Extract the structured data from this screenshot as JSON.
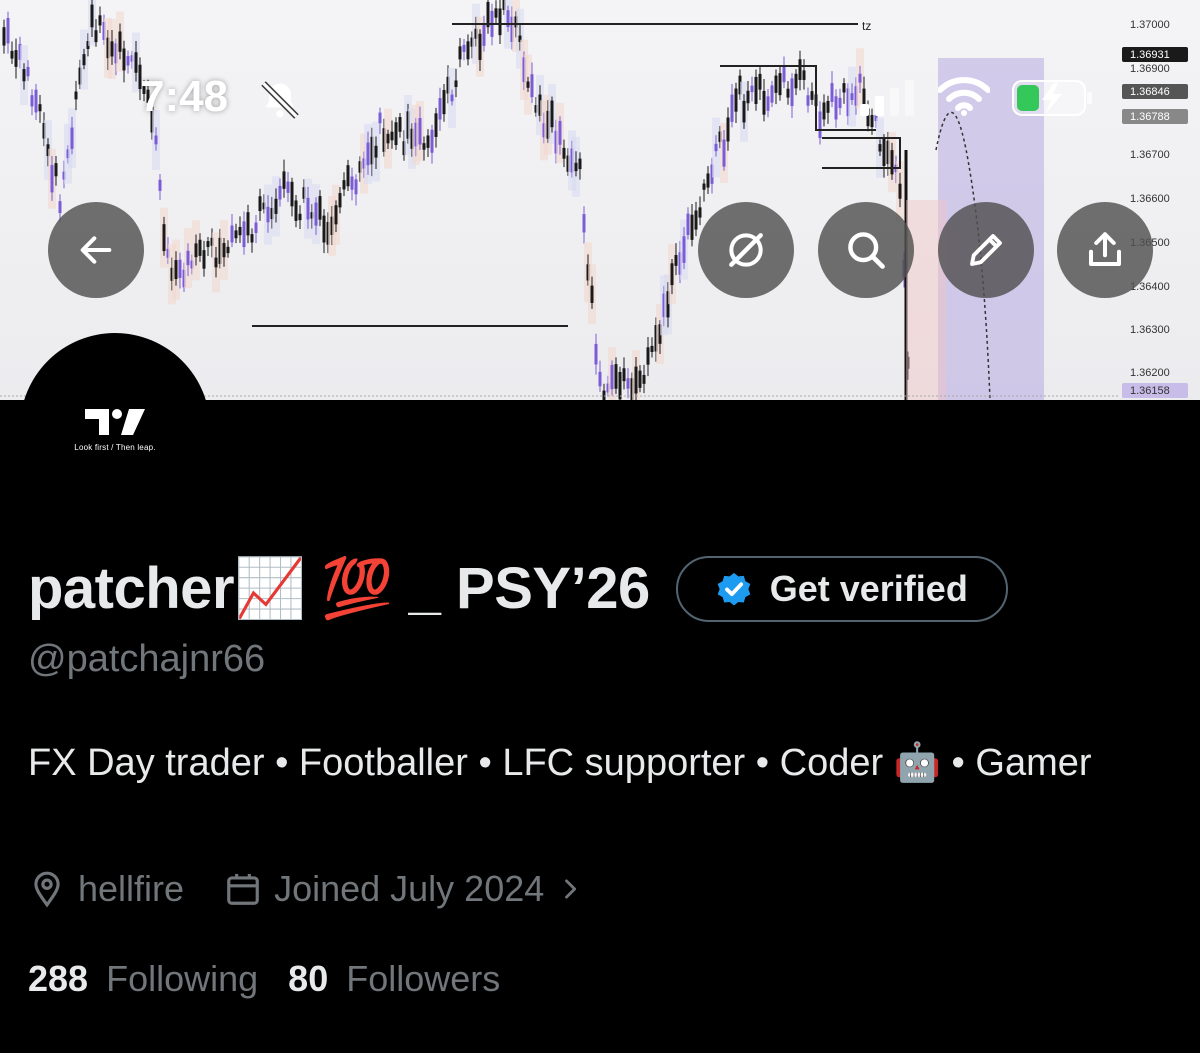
{
  "status_bar": {
    "time": "7:48"
  },
  "banner": {
    "price_axis": [
      "1.37000",
      "1.36931",
      "1.36900",
      "1.36846",
      "1.36788",
      "1.36700",
      "1.36600",
      "1.36500",
      "1.36400",
      "1.36300",
      "1.36200",
      "1.36158"
    ],
    "level_label": "tz"
  },
  "avatar": {
    "logo_text": "TV",
    "tagline": "Look first / Then leap."
  },
  "profile": {
    "display_name": "patcher📈 💯 _ PSY’26",
    "get_verified_label": "Get verified",
    "handle": "@patchajnr66",
    "bio": "FX Day trader • Footballer • LFC supporter • Coder 🤖 • Gamer",
    "location": "hellfire",
    "joined": "Joined July 2024",
    "following_count": "288",
    "following_label": "Following",
    "followers_count": "80",
    "followers_label": "Followers"
  },
  "colors": {
    "background": "#000000",
    "text_primary": "#e7e9ea",
    "text_secondary": "#71767b",
    "verified_blue": "#1d9bf0",
    "candle_purple": "#7b5cd6"
  }
}
